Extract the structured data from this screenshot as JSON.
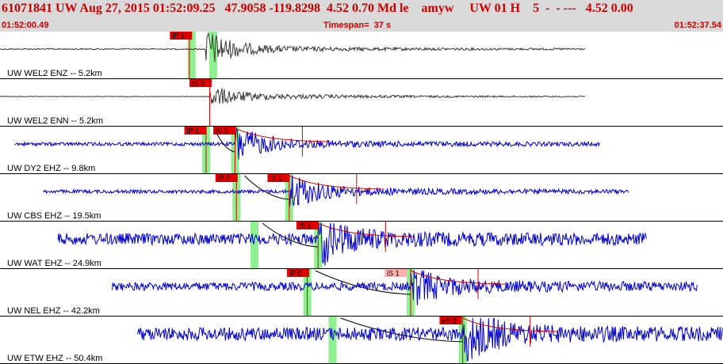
{
  "header": {
    "title": "61071841 UW Aug 27, 2015 01:52:09.25   47.9058 -119.8298  4.52 0.70 Md le    amyw     UW 01 H    5  -  - ---   4.52 0.00",
    "start_time": "01:52:00.49",
    "timespan": "Timespan=  37 s",
    "end_time": "01:52:37.54"
  },
  "colors": {
    "background": "#ffffff",
    "header_bg": "#d9d9d9",
    "title": "#cc0000",
    "trace_blue": "#0000cc",
    "trace_gray": "#3a3a3a",
    "pick_window": "#8ef08e",
    "pick_flag": "#e00000",
    "pick_flag_alt": "#ffb0b0",
    "model_curve": "#000000",
    "coda_curve": "#d40000"
  },
  "traces": [
    {
      "label": "UW WEL2 ENZ -- 5.2km",
      "color": "gray",
      "amp": 1,
      "t0": 0.0,
      "t1": 0.81,
      "arrival": 0.285,
      "picks": [
        {
          "label": "iP 1",
          "t": 0.262,
          "flag_t": 0.235,
          "style": "red"
        }
      ],
      "windows": [
        0.265,
        0.295
      ]
    },
    {
      "label": "UW WEL2 ENN -- 5.2km",
      "color": "gray",
      "amp": 0.5,
      "t0": 0.0,
      "t1": 0.81,
      "arrival": 0.29,
      "picks": [
        {
          "label": "iS 0",
          "t": 0.29,
          "flag_t": 0.262,
          "style": "red"
        }
      ],
      "windows": []
    },
    {
      "label": "UW DY2 EHZ -- 9.8km",
      "color": "blue",
      "amp": 1,
      "t0": 0.02,
      "t1": 0.83,
      "arrival": 0.325,
      "picks": [
        {
          "label": "iP 1",
          "t": 0.285,
          "flag_t": 0.255,
          "style": "red"
        },
        {
          "label": "iS 1",
          "t": 0.325,
          "flag_t": 0.295,
          "style": "red"
        }
      ],
      "windows": [
        0.285,
        0.325
      ]
    },
    {
      "label": "UW CBS EHZ -- 19.5km",
      "color": "blue",
      "amp": 1,
      "t0": 0.06,
      "t1": 0.87,
      "arrival": 0.4,
      "picks": [
        {
          "label": "iP 0",
          "t": 0.327,
          "flag_t": 0.298,
          "style": "red"
        },
        {
          "label": "iS 1",
          "t": 0.4,
          "flag_t": 0.37,
          "style": "red"
        }
      ],
      "windows": [
        0.327,
        0.4
      ]
    },
    {
      "label": "UW WAT EHZ -- 24.9km",
      "color": "blue",
      "amp": 1.4,
      "t0": 0.08,
      "t1": 0.895,
      "arrival": 0.44,
      "picks": [
        {
          "label": "iS 1",
          "t": 0.44,
          "flag_t": 0.41,
          "style": "red"
        }
      ],
      "windows": [
        0.352,
        0.44
      ]
    },
    {
      "label": "UW NEL EHZ -- 42.2km",
      "color": "blue",
      "amp": 1,
      "t0": 0.155,
      "t1": 0.965,
      "arrival": 0.568,
      "picks": [
        {
          "label": "iP 0",
          "t": 0.425,
          "flag_t": 0.397,
          "style": "red"
        },
        {
          "label": "iS 1",
          "t": 0.568,
          "flag_t": 0.532,
          "style": "pink"
        }
      ],
      "windows": [
        0.425,
        0.568
      ]
    },
    {
      "label": "UW ETW EHZ -- 50.4km",
      "color": "blue",
      "amp": 1.6,
      "t0": 0.19,
      "t1": 1.0,
      "arrival": 0.64,
      "picks": [
        {
          "label": "eS 2",
          "t": 0.64,
          "flag_t": 0.608,
          "style": "red"
        }
      ],
      "windows": [
        0.46,
        0.64
      ]
    }
  ]
}
